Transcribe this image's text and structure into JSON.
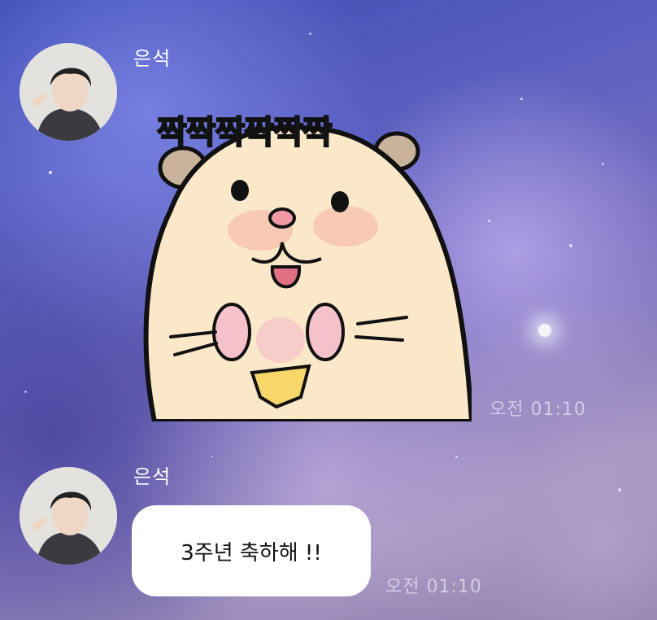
{
  "messages": [
    {
      "sender": "은석",
      "sticker": {
        "caption": "짝짝짝짝짝짝",
        "description": "hamster-clapping"
      },
      "time": "오전 01:10"
    },
    {
      "sender": "은석",
      "text": "3주년 축하해 !!",
      "time": "오전 01:10"
    }
  ]
}
